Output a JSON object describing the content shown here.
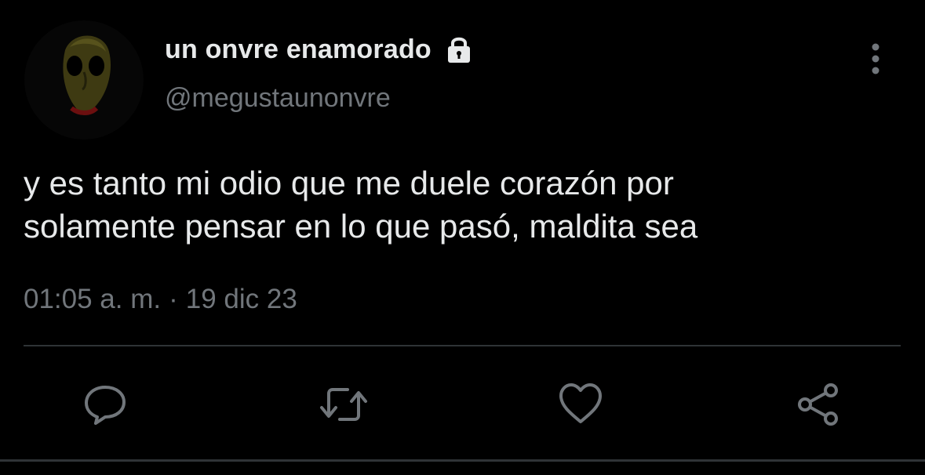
{
  "author": {
    "display_name": "un onvre enamorado",
    "handle": "@megustaunonvre",
    "avatar_icon": "baldi-face-avatar",
    "protected_icon": "lock-icon"
  },
  "tweet": {
    "text": "y es tanto mi odio que me duele corazón por\nsolamente pensar en lo que pasó, maldita sea",
    "time": "01:05 a. m.",
    "separator": "·",
    "date": "19 dic 23"
  },
  "actions": [
    {
      "name": "reply",
      "icon": "reply-icon"
    },
    {
      "name": "retweet",
      "icon": "retweet-icon"
    },
    {
      "name": "like",
      "icon": "heart-icon"
    },
    {
      "name": "share",
      "icon": "share-icon"
    }
  ],
  "colors": {
    "background": "#000000",
    "primary_text": "#e7e9ea",
    "secondary_text": "#71767b",
    "divider": "#2f3336",
    "action_icon": "#71767b"
  }
}
